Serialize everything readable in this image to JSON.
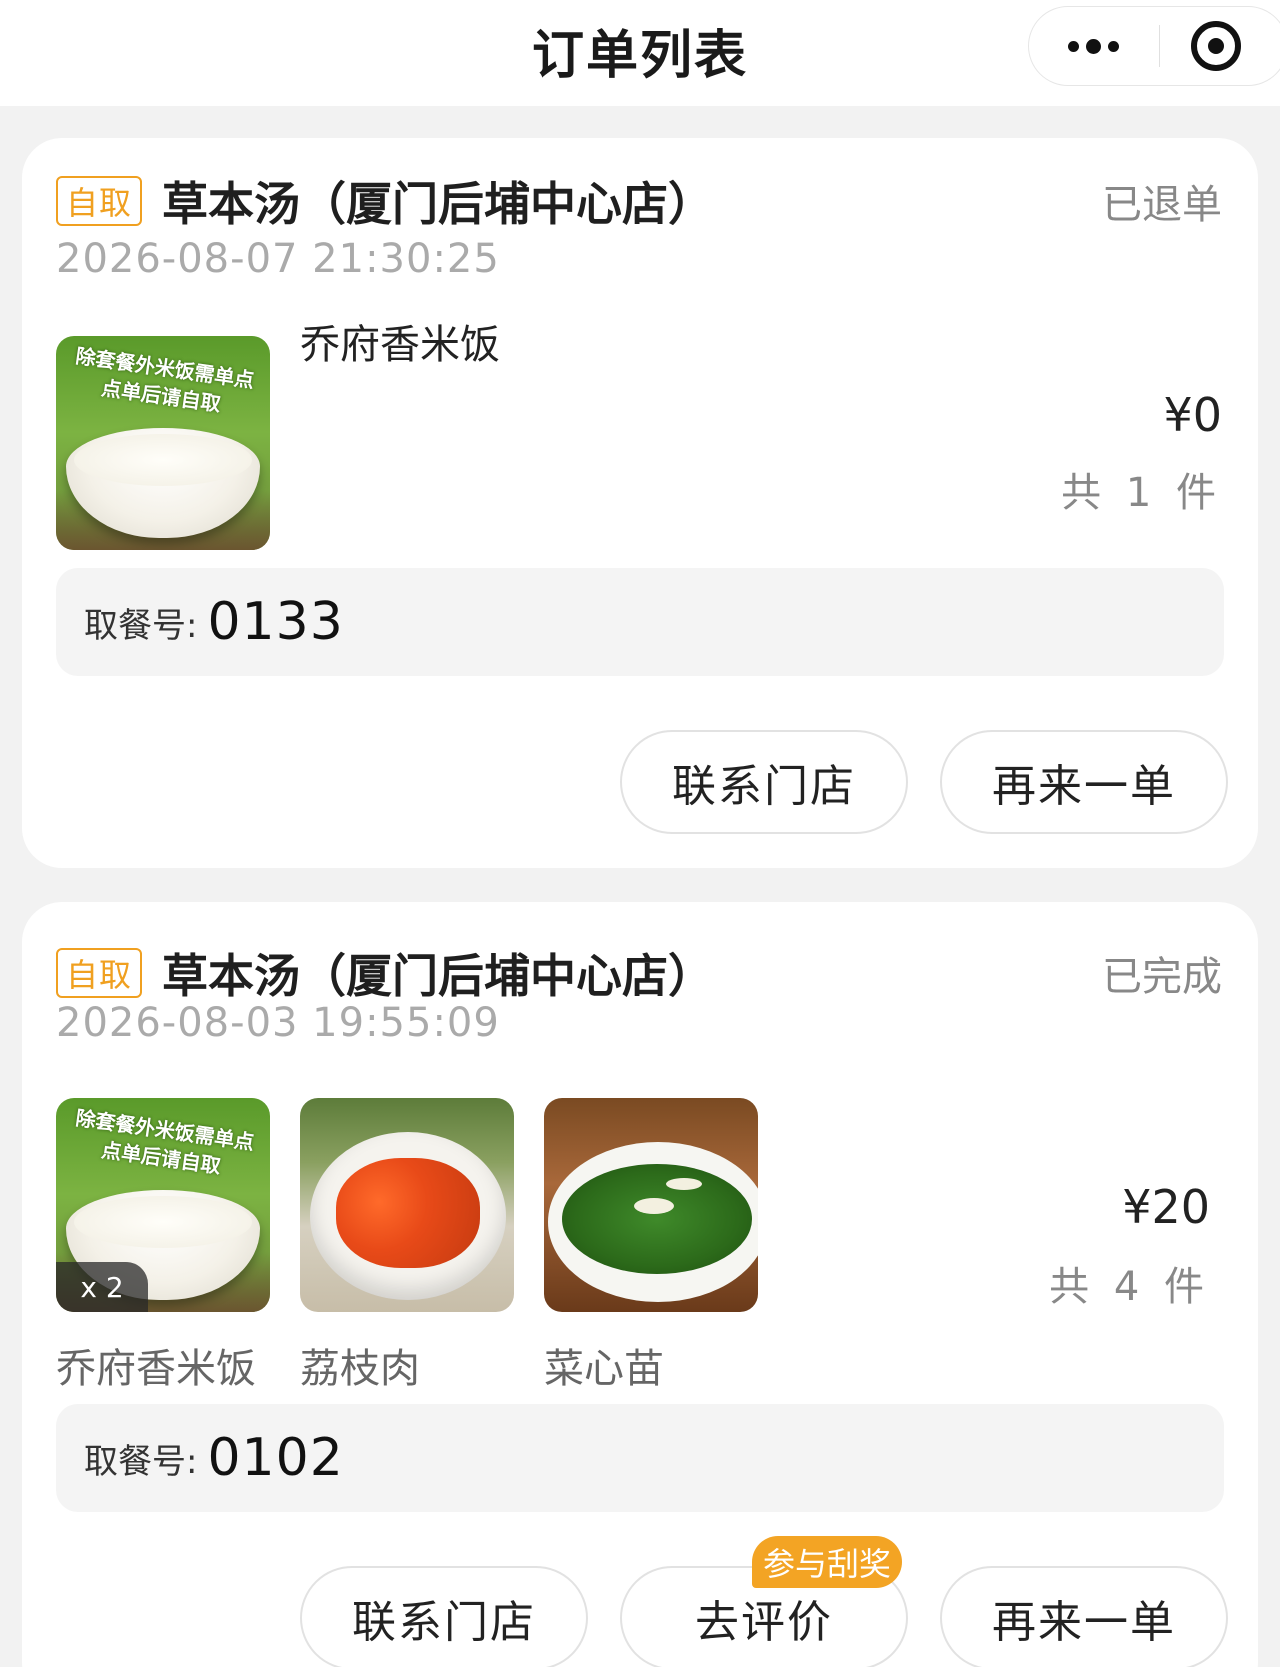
{
  "header": {
    "title": "订单列表"
  },
  "orders": [
    {
      "badge": "自取",
      "store": "草本汤（厦门后埔中心店）",
      "status": "已退单",
      "time": "2026-08-07 21:30:25",
      "items": [
        {
          "name": "乔府香米饭",
          "banner": "除套餐外米饭需单点 点单后请自取"
        }
      ],
      "price": "¥0",
      "count": "共 1 件",
      "pickup_label": "取餐号:",
      "pickup_number": "0133",
      "buttons": [
        "联系门店",
        "再来一单"
      ]
    },
    {
      "badge": "自取",
      "store": "草本汤（厦门后埔中心店）",
      "status": "已完成",
      "time": "2026-08-03 19:55:09",
      "items": [
        {
          "name": "乔府香米饭",
          "qty": "x 2",
          "banner": "除套餐外米饭需单点 点单后请自取"
        },
        {
          "name": "荔枝肉"
        },
        {
          "name": "菜心苗"
        }
      ],
      "price": "¥20",
      "count": "共 4 件",
      "pickup_label": "取餐号:",
      "pickup_number": "0102",
      "buttons": [
        "联系门店",
        "去评价",
        "再来一单"
      ],
      "raffle_tag": "参与刮奖"
    }
  ],
  "colors": {
    "badge": "#f0a020",
    "raffle": "#f3a424"
  }
}
